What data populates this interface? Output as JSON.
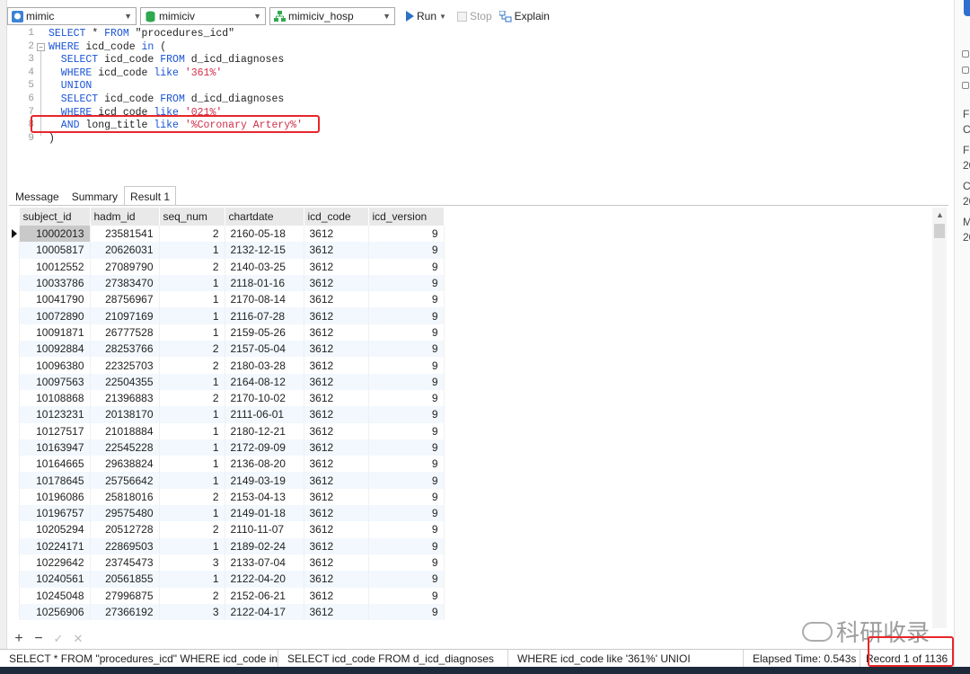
{
  "toolbar": {
    "connection": "mimic",
    "database": "mimiciv",
    "schema": "mimiciv_hosp",
    "run_label": "Run",
    "stop_label": "Stop",
    "explain_label": "Explain"
  },
  "editor": {
    "line_numbers": [
      "1",
      "2",
      "3",
      "4",
      "5",
      "6",
      "7",
      "8",
      "9"
    ],
    "lines": [
      [
        {
          "t": "SELECT",
          "c": "kw"
        },
        {
          "t": " * ",
          "c": "id"
        },
        {
          "t": "FROM",
          "c": "kw"
        },
        {
          "t": " \"procedures_icd\"",
          "c": "id"
        }
      ],
      [
        {
          "t": "WHERE",
          "c": "kw"
        },
        {
          "t": " icd_code ",
          "c": "id"
        },
        {
          "t": "in",
          "c": "kw"
        },
        {
          "t": " (",
          "c": "id"
        }
      ],
      [
        {
          "t": "  SELECT",
          "c": "kw"
        },
        {
          "t": " icd_code ",
          "c": "id"
        },
        {
          "t": "FROM",
          "c": "kw"
        },
        {
          "t": " d_icd_diagnoses",
          "c": "id"
        }
      ],
      [
        {
          "t": "  WHERE",
          "c": "kw"
        },
        {
          "t": " icd_code ",
          "c": "id"
        },
        {
          "t": "like",
          "c": "kw"
        },
        {
          "t": " '361%'",
          "c": "str"
        }
      ],
      [
        {
          "t": "  UNION",
          "c": "kw"
        }
      ],
      [
        {
          "t": "  SELECT",
          "c": "kw"
        },
        {
          "t": " icd_code ",
          "c": "id"
        },
        {
          "t": "FROM",
          "c": "kw"
        },
        {
          "t": " d_icd_diagnoses",
          "c": "id"
        }
      ],
      [
        {
          "t": "  WHERE",
          "c": "kw"
        },
        {
          "t": " icd_code ",
          "c": "id"
        },
        {
          "t": "like",
          "c": "kw"
        },
        {
          "t": " '021%'",
          "c": "str"
        }
      ],
      [
        {
          "t": "  AND",
          "c": "kw"
        },
        {
          "t": " long_title ",
          "c": "id"
        },
        {
          "t": "like",
          "c": "kw"
        },
        {
          "t": " '%Coronary Artery%'",
          "c": "str"
        }
      ],
      [
        {
          "t": ")",
          "c": "id"
        }
      ]
    ]
  },
  "tabs": [
    "Message",
    "Summary",
    "Result 1"
  ],
  "active_tab": "Result 1",
  "grid": {
    "columns": [
      "subject_id",
      "hadm_id",
      "seq_num",
      "chartdate",
      "icd_code",
      "icd_version"
    ],
    "rows": [
      [
        "10002013",
        "23581541",
        "2",
        "2160-05-18",
        "3612",
        "9"
      ],
      [
        "10005817",
        "20626031",
        "1",
        "2132-12-15",
        "3612",
        "9"
      ],
      [
        "10012552",
        "27089790",
        "2",
        "2140-03-25",
        "3612",
        "9"
      ],
      [
        "10033786",
        "27383470",
        "1",
        "2118-01-16",
        "3612",
        "9"
      ],
      [
        "10041790",
        "28756967",
        "1",
        "2170-08-14",
        "3612",
        "9"
      ],
      [
        "10072890",
        "21097169",
        "1",
        "2116-07-28",
        "3612",
        "9"
      ],
      [
        "10091871",
        "26777528",
        "1",
        "2159-05-26",
        "3612",
        "9"
      ],
      [
        "10092884",
        "28253766",
        "2",
        "2157-05-04",
        "3612",
        "9"
      ],
      [
        "10096380",
        "22325703",
        "2",
        "2180-03-28",
        "3612",
        "9"
      ],
      [
        "10097563",
        "22504355",
        "1",
        "2164-08-12",
        "3612",
        "9"
      ],
      [
        "10108868",
        "21396883",
        "2",
        "2170-10-02",
        "3612",
        "9"
      ],
      [
        "10123231",
        "20138170",
        "1",
        "2111-06-01",
        "3612",
        "9"
      ],
      [
        "10127517",
        "21018884",
        "1",
        "2180-12-21",
        "3612",
        "9"
      ],
      [
        "10163947",
        "22545228",
        "1",
        "2172-09-09",
        "3612",
        "9"
      ],
      [
        "10164665",
        "29638824",
        "1",
        "2136-08-20",
        "3612",
        "9"
      ],
      [
        "10178645",
        "25756642",
        "1",
        "2149-03-19",
        "3612",
        "9"
      ],
      [
        "10196086",
        "25818016",
        "2",
        "2153-04-13",
        "3612",
        "9"
      ],
      [
        "10196757",
        "29575480",
        "1",
        "2149-01-18",
        "3612",
        "9"
      ],
      [
        "10205294",
        "20512728",
        "2",
        "2110-11-07",
        "3612",
        "9"
      ],
      [
        "10224171",
        "22869503",
        "1",
        "2189-02-24",
        "3612",
        "9"
      ],
      [
        "10229642",
        "23745473",
        "3",
        "2133-07-04",
        "3612",
        "9"
      ],
      [
        "10240561",
        "20561855",
        "1",
        "2122-04-20",
        "3612",
        "9"
      ],
      [
        "10245048",
        "27996875",
        "2",
        "2152-06-21",
        "3612",
        "9"
      ],
      [
        "10256906",
        "27366192",
        "3",
        "2122-04-17",
        "3612",
        "9"
      ]
    ]
  },
  "gridbar": {
    "add": "+",
    "remove": "−",
    "apply": "✓",
    "discard": "✕"
  },
  "status": {
    "query1": "SELECT * FROM \"procedures_icd\" WHERE icd_code in (",
    "query2": "SELECT icd_code FROM d_icd_diagnoses",
    "query3": "WHERE icd_code like '361%'  UNIOI",
    "elapsed": "Elapsed Time: 0.543s",
    "record": "Record 1 of 1136"
  },
  "right_panel": {
    "texts": [
      "Fi",
      "C",
      "Fi",
      "20",
      "C",
      "20",
      "M",
      "20"
    ]
  },
  "watermark": "科研收录",
  "colors": {
    "keyword": "#1a53d6",
    "string": "#d0304a",
    "highlight": "#e8262a",
    "alt_row": "#f2f8fd"
  }
}
